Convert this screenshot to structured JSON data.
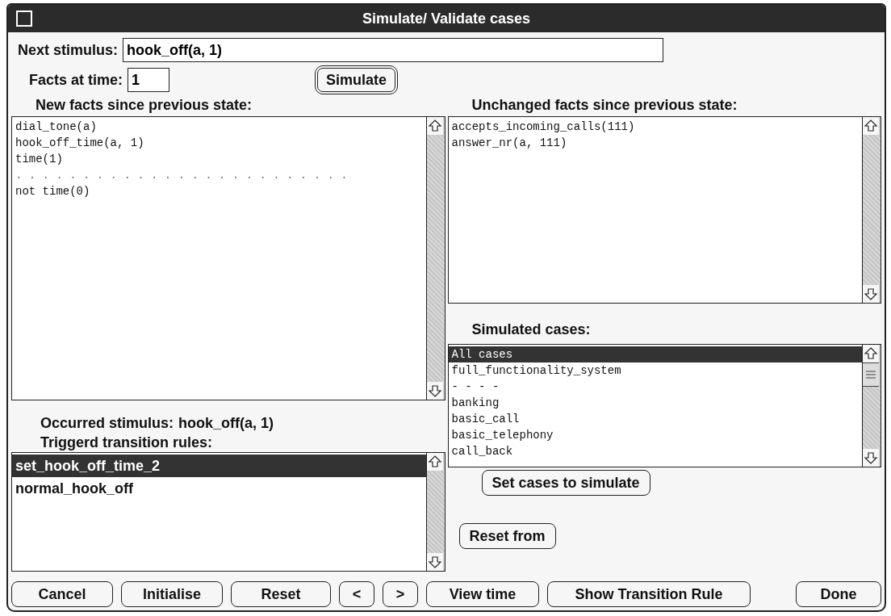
{
  "window": {
    "title": "Simulate/ Validate cases"
  },
  "next_stimulus": {
    "label": "Next stimulus:",
    "value": "hook_off(a, 1)"
  },
  "facts_at_time": {
    "label": "Facts at time:",
    "value": "1"
  },
  "simulate_button": {
    "label": "Simulate",
    "default": true
  },
  "new_facts": {
    "heading": "New facts since previous state:",
    "items": [
      {
        "text": "dial_tone(a)",
        "kind": "fact"
      },
      {
        "text": "hook_off_time(a, 1)",
        "kind": "fact"
      },
      {
        "text": "time(1)",
        "kind": "fact"
      },
      {
        "text": ". . . . . . . . . . . . . . . . . . . . . . . . .",
        "kind": "separator"
      },
      {
        "text": "not time(0)",
        "kind": "fact"
      }
    ]
  },
  "unchanged_facts": {
    "heading": "Unchanged facts since previous state:",
    "items": [
      {
        "text": "accepts_incoming_calls(111)"
      },
      {
        "text": "answer_nr(a, 111)"
      }
    ]
  },
  "occurred_stimulus": {
    "label": "Occurred stimulus:",
    "value": "hook_off(a, 1)"
  },
  "transition_rules": {
    "heading": "Triggerd transition rules:",
    "items": [
      {
        "text": "set_hook_off_time_2",
        "selected": true
      },
      {
        "text": "normal_hook_off",
        "selected": false
      }
    ]
  },
  "simulated_cases": {
    "heading": "Simulated cases:",
    "items": [
      {
        "text": "All cases",
        "selected": true
      },
      {
        "text": "full_functionality_system",
        "selected": false
      },
      {
        "text": "- - - -",
        "selected": false
      },
      {
        "text": "banking",
        "selected": false
      },
      {
        "text": "basic_call",
        "selected": false
      },
      {
        "text": "basic_telephony",
        "selected": false
      },
      {
        "text": "call_back",
        "selected": false
      }
    ]
  },
  "case_buttons": [
    "Set cases to simulate",
    "Reset from"
  ],
  "buttons": [
    "Cancel",
    "Initialise",
    "Reset",
    "<",
    ">",
    "View time",
    "Show Transition Rule",
    "Done"
  ]
}
